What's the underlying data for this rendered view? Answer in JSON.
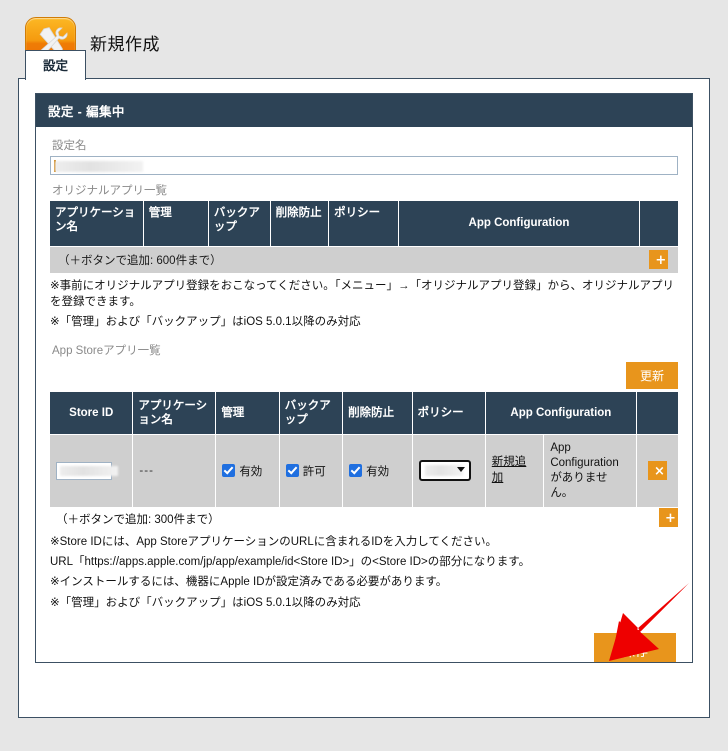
{
  "header": {
    "title": "新規作成",
    "icon": "tools-icon"
  },
  "tabs": [
    {
      "label": "設定",
      "active": true
    }
  ],
  "card": {
    "header_title": "設定 - 編集中",
    "setting_name": {
      "label": "設定名",
      "value": "",
      "placeholder": ""
    }
  },
  "original_apps": {
    "section_label": "オリジナルアプリ一覧",
    "columns": [
      "アプリケーション名",
      "管理",
      "バックアップ",
      "削除防止",
      "ポリシー",
      "App Configuration",
      ""
    ],
    "add_hint": "（＋ボタンで追加: 600件まで）",
    "add_button": "+",
    "notes": [
      "※事前にオリジナルアプリ登録をおこなってください。「メニュー」→「オリジナルアプリ登録」から、オリジナルアプリを登録できます。",
      "※「管理」および「バックアップ」はiOS 5.0.1以降のみ対応"
    ]
  },
  "store_apps": {
    "section_label": "App Storeアプリ一覧",
    "update_button": "更新",
    "columns": [
      "Store ID",
      "アプリケーション名",
      "管理",
      "バックアップ",
      "削除防止",
      "ポリシー",
      "App Configuration",
      ""
    ],
    "rows": [
      {
        "store_id": "",
        "app_name": "---",
        "manage": {
          "checked": true,
          "label": "有効"
        },
        "backup": {
          "checked": true,
          "label": "許可"
        },
        "prevent_delete": {
          "checked": true,
          "label": "有効"
        },
        "policy": {
          "value": ""
        },
        "config_link": "新規追加",
        "config_message": "App Configurationがありません。",
        "delete_button": "×"
      }
    ],
    "add_hint": "（＋ボタンで追加: 300件まで）",
    "add_button": "+",
    "notes": [
      "※Store IDには、App StoreアプリケーションのURLに含まれるIDを入力してください。",
      "URL「https://apps.apple.com/jp/app/example/id<Store ID>」の<Store ID>の部分になります。",
      "※インストールするには、機器にApple IDが設定済みである必要があります。",
      "※「管理」および「バックアップ」はiOS 5.0.1以降のみ対応"
    ]
  },
  "footer": {
    "save_button": "保存"
  },
  "annotation": {
    "arrow": "red-arrow-pointing-to-save",
    "color": "#ee0000"
  },
  "colors": {
    "accent_orange": "#e8951c",
    "header_navy": "#2d4356",
    "page_bg": "#e6e6e6",
    "row_grey": "#cfcfcf",
    "checkbox_blue": "#1f6fe0",
    "arrow_red": "#ee0000"
  }
}
